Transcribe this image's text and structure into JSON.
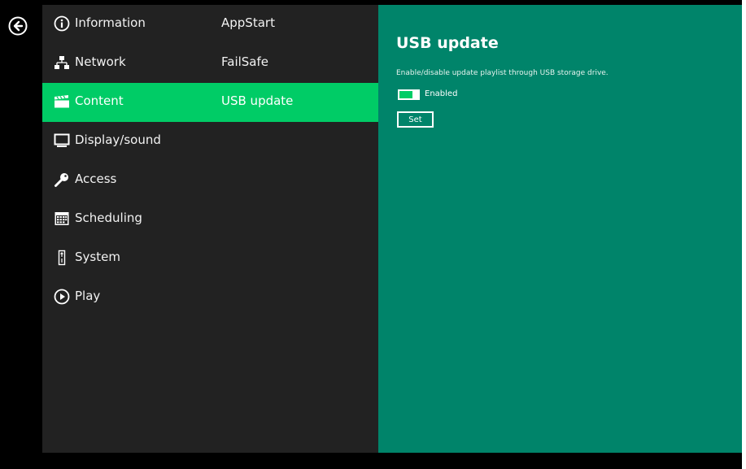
{
  "colors": {
    "background": "#000000",
    "menu_bg": "#222222",
    "selected_bg": "#00cc66",
    "content_bg": "#00846a",
    "text": "#ffffff"
  },
  "back_button": {
    "icon": "arrow-left-circle-icon"
  },
  "menu": {
    "items": [
      {
        "label": "Information",
        "icon": "info-circle-icon",
        "sublabel": "AppStart",
        "selected": false
      },
      {
        "label": "Network",
        "icon": "network-icon",
        "sublabel": "FailSafe",
        "selected": false
      },
      {
        "label": "Content",
        "icon": "clapperboard-icon",
        "sublabel": "USB update",
        "selected": true
      },
      {
        "label": "Display/sound",
        "icon": "monitor-icon",
        "selected": false
      },
      {
        "label": "Access",
        "icon": "key-icon",
        "selected": false
      },
      {
        "label": "Scheduling",
        "icon": "calendar-icon",
        "selected": false
      },
      {
        "label": "System",
        "icon": "system-icon",
        "selected": false
      },
      {
        "label": "Play",
        "icon": "play-circle-icon",
        "selected": false
      }
    ]
  },
  "panel": {
    "title": "USB update",
    "description": "Enable/disable update playlist through USB storage drive.",
    "toggle": {
      "state": "on",
      "label": "Enabled"
    },
    "set_button": "Set"
  }
}
